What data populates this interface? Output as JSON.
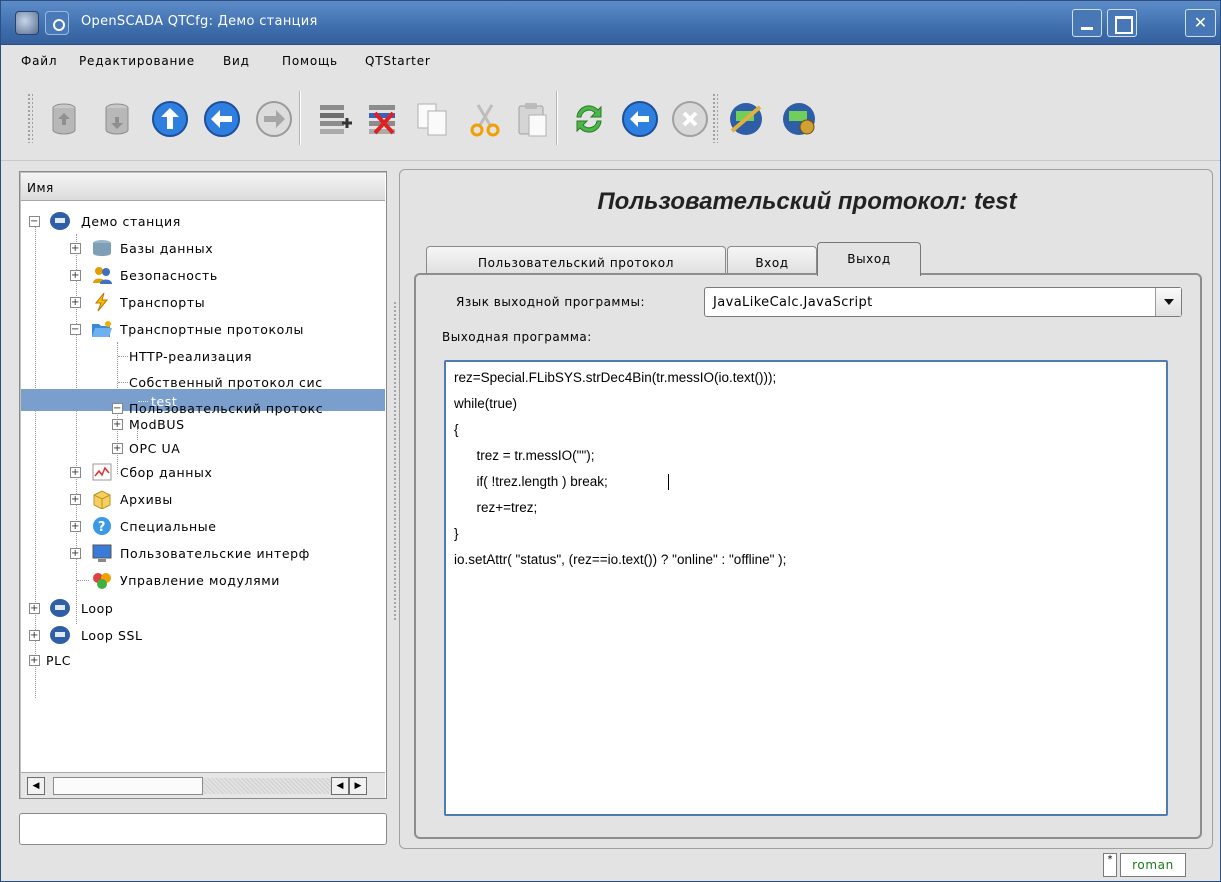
{
  "window": {
    "title": "OpenSCADA QTCfg: Демо станция"
  },
  "menu": [
    {
      "label": "Файл"
    },
    {
      "label": "Редактирование"
    },
    {
      "label": "Вид"
    },
    {
      "label": "Помощь"
    },
    {
      "label": "QTStarter"
    }
  ],
  "toolbar": {
    "icons": [
      "database-load-icon",
      "database-save-icon",
      "up-icon",
      "back-icon",
      "forward-icon",
      "add-item-icon",
      "delete-item-icon",
      "copy-icon",
      "cut-icon",
      "paste-icon",
      "refresh-icon",
      "start-icon",
      "stop-icon",
      "station-link-icon",
      "station-config-icon"
    ]
  },
  "tree": {
    "header": "Имя",
    "items": [
      {
        "label": "Демо станция"
      },
      {
        "label": "Базы данных"
      },
      {
        "label": "Безопасность"
      },
      {
        "label": "Транспорты"
      },
      {
        "label": "Транспортные протоколы"
      },
      {
        "label": "HTTP-реализация"
      },
      {
        "label": "Собственный протокол сис"
      },
      {
        "label": "Пользовательский протокс"
      },
      {
        "label": "test"
      },
      {
        "label": "ModBUS"
      },
      {
        "label": "OPC UA"
      },
      {
        "label": "Сбор данных"
      },
      {
        "label": "Архивы"
      },
      {
        "label": "Специальные"
      },
      {
        "label": "Пользовательские интерф"
      },
      {
        "label": "Управление модулями"
      },
      {
        "label": "Loop"
      },
      {
        "label": "Loop SSL"
      },
      {
        "label": "PLC"
      }
    ]
  },
  "page": {
    "title": "Пользовательский протокол: test",
    "tabs": [
      {
        "label": "Пользовательский протокол"
      },
      {
        "label": "Вход"
      },
      {
        "label": "Выход"
      }
    ],
    "lang_label": "Язык выходной программы:",
    "lang_value": "JavaLikeCalc.JavaScript",
    "program_label": "Выходная программа:",
    "code_lines": [
      "rez=Special.FLibSYS.strDec4Bin(tr.messIO(io.text()));",
      "while(true)",
      "{",
      "      trez = tr.messIO(\"\");",
      "      if( !trez.length ) break;",
      "      rez+=trez;",
      "}",
      "io.setAttr( \"status\", (rez==io.text()) ? \"online\" : \"offline\" );"
    ]
  },
  "status": {
    "corner": "*",
    "user": "roman"
  },
  "colors": {
    "titlebar": "#3f6fae",
    "selection": "#7b9fcc",
    "editor_border": "#4f7cb4",
    "user_text": "#1b7a1b"
  }
}
